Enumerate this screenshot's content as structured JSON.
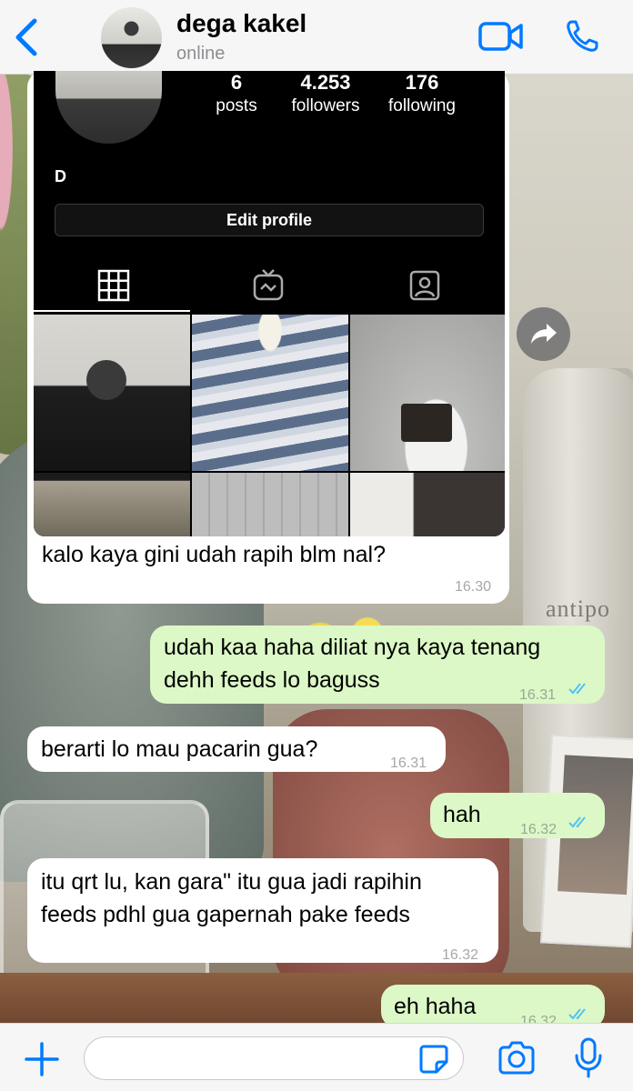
{
  "header": {
    "contact_name": "dega kakel",
    "status": "online"
  },
  "instagram_screenshot": {
    "stats": [
      {
        "value": "6",
        "label": "posts"
      },
      {
        "value": "4.253",
        "label": "followers"
      },
      {
        "value": "176",
        "label": "following"
      }
    ],
    "bio": "D",
    "edit_button": "Edit profile"
  },
  "messages": [
    {
      "id": "m1",
      "direction": "incoming",
      "text": "kalo kaya gini udah rapih blm nal?",
      "time": "16.30"
    },
    {
      "id": "m2",
      "direction": "outgoing",
      "lines": [
        "udah kaa haha diliat nya kaya tenang",
        "dehh feeds lo baguss"
      ],
      "time": "16.31",
      "read": true
    },
    {
      "id": "m3",
      "direction": "incoming",
      "text": "berarti lo mau pacarin gua?",
      "time": "16.31"
    },
    {
      "id": "m4",
      "direction": "outgoing",
      "text": "hah",
      "time": "16.32",
      "read": true
    },
    {
      "id": "m5",
      "direction": "incoming",
      "lines": [
        "itu qrt lu, kan gara\" itu gua jadi rapihin",
        "feeds pdhl gua gapernah pake feeds"
      ],
      "time": "16.32"
    },
    {
      "id": "m6",
      "direction": "outgoing",
      "text": "eh haha",
      "time": "16.32",
      "read": true
    }
  ],
  "composer": {
    "placeholder": ""
  },
  "wallpaper": {
    "bottle_label": "antipo"
  },
  "colors": {
    "accent": "#007aff",
    "outgoing_bubble": "#dcf8c6",
    "incoming_bubble": "#ffffff",
    "read_ticks": "#4fc3f7"
  },
  "icons": [
    "back-chevron-icon",
    "video-call-icon",
    "phone-icon",
    "forward-icon",
    "grid-icon",
    "igtv-icon",
    "tagged-icon",
    "plus-icon",
    "sticker-icon",
    "camera-icon",
    "microphone-icon",
    "read-ticks-icon"
  ]
}
